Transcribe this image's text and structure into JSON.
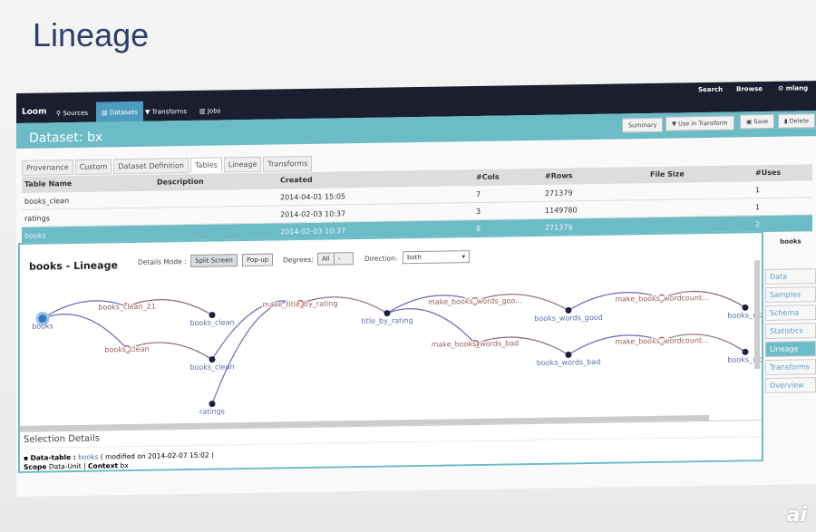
{
  "slide_title": "Lineage",
  "watermark": "ai",
  "nav": {
    "brand": "Loom",
    "items": [
      "Sources",
      "Datasets",
      "Transforms",
      "Jobs"
    ],
    "right": [
      "Search",
      "Browse",
      "mlang"
    ]
  },
  "header": {
    "title": "Dataset: bx",
    "buttons": [
      "Summary",
      "Use in Transform",
      "Save",
      "Delete"
    ]
  },
  "tabs": [
    "Provenance",
    "Custom",
    "Dataset Definition",
    "Tables",
    "Lineage",
    "Transforms"
  ],
  "table": {
    "columns": [
      "Table Name",
      "Description",
      "Created",
      "#Cols",
      "#Rows",
      "File Size",
      "#Uses"
    ],
    "rows": [
      [
        "books_clean",
        "",
        "2014-04-01 15:05",
        "7",
        "271379",
        "",
        "1"
      ],
      [
        "ratings",
        "",
        "2014-02-03 10:37",
        "3",
        "1149780",
        "",
        "1"
      ],
      [
        "books",
        "",
        "2014-02-03 10:37",
        "8",
        "271379",
        "",
        "2"
      ]
    ]
  },
  "lineage": {
    "title": "books - Lineage",
    "details_mode_label": "Details Mode :",
    "modes": [
      "Split Screen",
      "Pop-up"
    ],
    "degrees_label": "Degrees:",
    "degrees_value": "All",
    "degrees_other": "-",
    "direction_label": "Direction:",
    "direction_value": "both",
    "nodes": [
      {
        "label": "books",
        "type": "selected"
      },
      {
        "label": "books_clean_21",
        "type": "transform"
      },
      {
        "label": "books_clean",
        "type": "data"
      },
      {
        "label": "books_clean",
        "type": "transform"
      },
      {
        "label": "books_clean",
        "type": "data"
      },
      {
        "label": "make_title_by_rating",
        "type": "transform"
      },
      {
        "label": "ratings",
        "type": "data"
      },
      {
        "label": "title_by_rating",
        "type": "data"
      },
      {
        "label": "make_books_words_goo...",
        "type": "transform"
      },
      {
        "label": "books_words_good",
        "type": "data"
      },
      {
        "label": "make_books_wordcount...",
        "type": "transform"
      },
      {
        "label": "books_wo",
        "type": "data"
      },
      {
        "label": "make_books_words_bad",
        "type": "transform"
      },
      {
        "label": "books_words_bad",
        "type": "data"
      },
      {
        "label": "make_books_wordcount...",
        "type": "transform"
      },
      {
        "label": "books_wo",
        "type": "data"
      }
    ],
    "edges": [
      [
        0,
        1
      ],
      [
        1,
        2
      ],
      [
        0,
        3
      ],
      [
        3,
        4
      ],
      [
        4,
        5
      ],
      [
        6,
        5
      ],
      [
        5,
        7
      ],
      [
        7,
        8
      ],
      [
        8,
        9
      ],
      [
        9,
        10
      ],
      [
        10,
        11
      ],
      [
        7,
        12
      ],
      [
        12,
        13
      ],
      [
        13,
        14
      ],
      [
        14,
        15
      ]
    ]
  },
  "selection": {
    "title": "Selection Details",
    "kind": "Data-table :",
    "name": "books",
    "modified": "( modified on 2014-02-07 15:02 )",
    "scope_label": "Scope",
    "scope": "Data-Unit |",
    "context_label": "Context",
    "context": "bx"
  },
  "side": {
    "header": "books",
    "items": [
      "Data",
      "Samples",
      "Schema",
      "Statistics",
      "Lineage",
      "Transforms",
      "Overview"
    ]
  }
}
